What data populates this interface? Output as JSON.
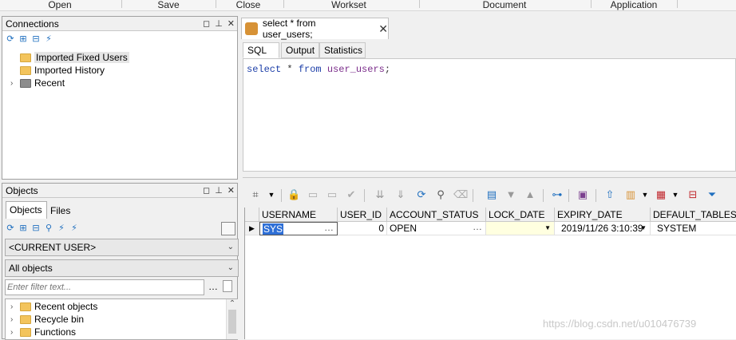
{
  "menubar": {
    "items": [
      "Open",
      "Save",
      "Close",
      "Workset",
      "Document",
      "Application"
    ]
  },
  "connections_panel": {
    "title": "Connections",
    "tree": [
      {
        "label": "Imported Fixed Users",
        "folder_color": "#f3c45c",
        "selected": true
      },
      {
        "label": "Imported History",
        "folder_color": "#f3c45c"
      },
      {
        "label": "Recent",
        "folder_color": "#8d8d8d",
        "expandable": true
      }
    ]
  },
  "objects_panel": {
    "title": "Objects",
    "tabs": [
      "Objects",
      "Files"
    ],
    "user_select": "<CURRENT USER>",
    "type_select": "All objects",
    "filter_placeholder": "Enter filter text...",
    "tree": [
      "Recent objects",
      "Recycle bin",
      "Functions"
    ]
  },
  "editor": {
    "doc_tab_title": "select * from user_users;",
    "sub_tabs": [
      "SQL",
      "Output",
      "Statistics"
    ],
    "active_sub_tab": "SQL",
    "sql": {
      "kw1": "select",
      "star": "*",
      "kw2": "from",
      "table": "user_users",
      "semicolon": ";"
    }
  },
  "grid": {
    "columns": [
      "USERNAME",
      "USER_ID",
      "ACCOUNT_STATUS",
      "LOCK_DATE",
      "EXPIRY_DATE",
      "DEFAULT_TABLESP"
    ],
    "rows": [
      {
        "USERNAME": "SYS",
        "USER_ID": "0",
        "ACCOUNT_STATUS": "OPEN",
        "LOCK_DATE": "",
        "EXPIRY_DATE": "2019/11/26 3:10:39",
        "DEFAULT_TABLESP": "SYSTEM"
      }
    ]
  },
  "watermark": "https://blog.csdn.net/u010476739",
  "colors": {
    "keyword": "#1c3ea8",
    "identifier": "#7a2c8a",
    "selection": "#2e6fd6",
    "lock_cell": "#ffffe0"
  }
}
